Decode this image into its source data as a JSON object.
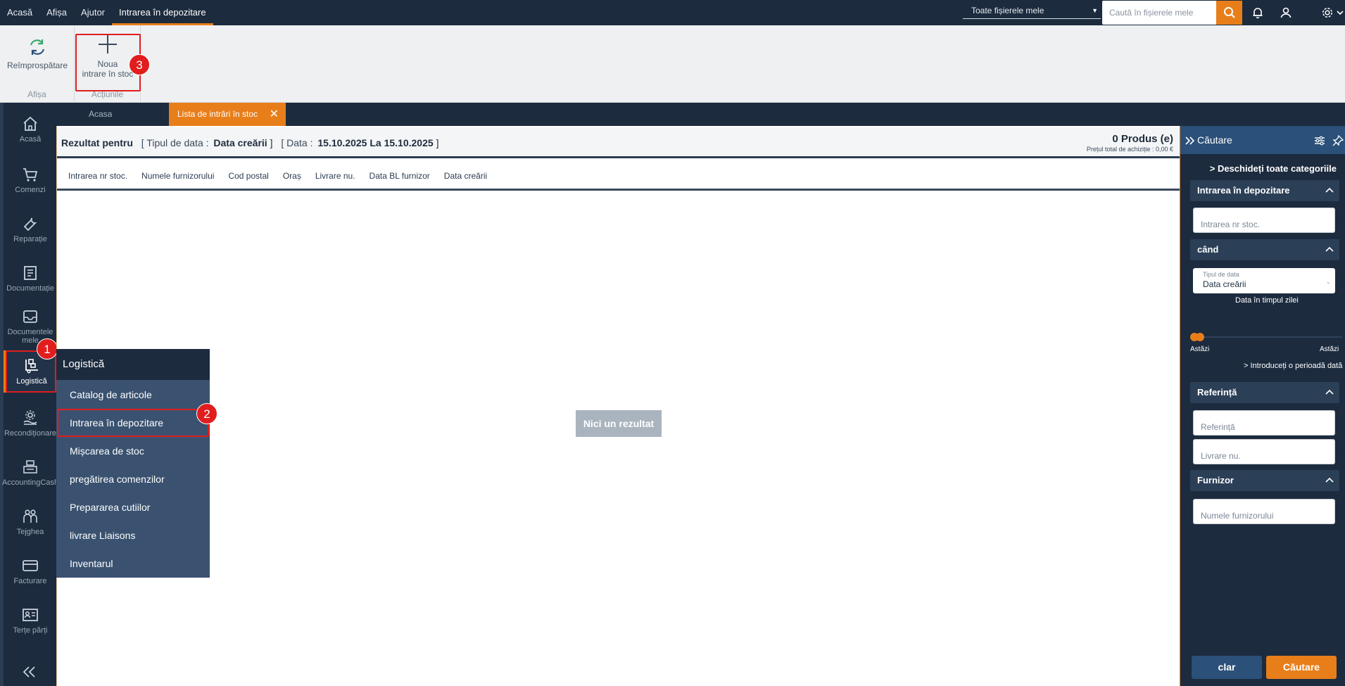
{
  "topmenu": {
    "items": [
      "Acasă",
      "Afișa",
      "Ajutor",
      "Intrarea în depozitare"
    ]
  },
  "topbar": {
    "files_select": "Toate fișierele mele",
    "search_placeholder": "Caută în fișierele mele"
  },
  "ribbon": {
    "refresh_label": "Reîmprospătare",
    "group_display": "Afișa",
    "new_entry_line1": "Noua",
    "new_entry_line2": "intrare în stoc",
    "group_actions": "Acțiunile"
  },
  "badges": [
    "1",
    "2",
    "3"
  ],
  "sidebar": {
    "items": [
      {
        "label": "Acasă",
        "icon": "home-icon"
      },
      {
        "label": "Comenzi",
        "icon": "cart-icon"
      },
      {
        "label": "Reparație",
        "icon": "wrench-icon"
      },
      {
        "label": "Documentație",
        "icon": "document-icon"
      },
      {
        "label": "Documentele mele",
        "icon": "inbox-icon"
      },
      {
        "label": "Logistică",
        "icon": "logistics-icon"
      },
      {
        "label": "Recondiționare",
        "icon": "recycle-icon"
      },
      {
        "label": "AccountingCash",
        "icon": "cash-register-icon"
      },
      {
        "label": "Tejghea",
        "icon": "people-icon"
      },
      {
        "label": "Facturare",
        "icon": "card-icon"
      },
      {
        "label": "Terțe părți",
        "icon": "id-card-icon"
      }
    ]
  },
  "tabs": {
    "home": "Acasa",
    "active": "Lista de intrări în stoc"
  },
  "result": {
    "prefix": "Rezultat pentru",
    "type_label": "[ Tipul de data :",
    "type_value": "Data creării",
    "close_bracket": "]",
    "date_label": "[ Data :",
    "date_from": "15.10.2025",
    "date_sep": "La",
    "date_to": "15.10.2025",
    "count": "0 Produs (e)",
    "price": "Prețul total de achiziție : 0,00 €"
  },
  "columns": [
    "Intrarea nr stoc.",
    "Numele furnizorului",
    "Cod postal",
    "Oraș",
    "Livrare nu.",
    "Data BL furnizor",
    "Data creării"
  ],
  "no_result": "Nici un rezultat",
  "dropdown": {
    "title": "Logistică",
    "items": [
      "Catalog de articole",
      "Intrarea în depozitare",
      "Mișcarea de stoc",
      "pregătirea comenzilor",
      "Prepararea cutiilor",
      "livrare Liaisons",
      "Inventarul"
    ]
  },
  "panel": {
    "title": "Căutare",
    "open_all": "Deschideți toate categoriile",
    "sec_entry": "Intrarea în depozitare",
    "entry_placeholder": "Intrarea nr stoc.",
    "sec_when": "când",
    "date_type_label": "Tipul de data",
    "date_type_value": "Data creării",
    "day_time": "Data în timpul zilei",
    "today_left": "Astăzi",
    "today_right": "Astăzi",
    "enter_period": "> Introduceți o perioadă dată",
    "sec_ref": "Referință",
    "ref_placeholder": "Referință",
    "delivery_placeholder": "Livrare nu.",
    "sec_supplier": "Furnizor",
    "supplier_placeholder": "Numele furnizorului",
    "clear_label": "clar",
    "search_label": "Căutare"
  },
  "colors": {
    "accent": "#e87e1a",
    "navy": "#1c2b3e",
    "highlight": "#e11d1d"
  }
}
